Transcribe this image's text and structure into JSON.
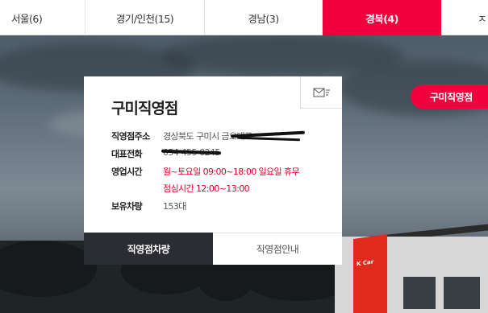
{
  "tabs": [
    {
      "label": "서울(6)"
    },
    {
      "label": "경기/인천(15)"
    },
    {
      "label": "경남(3)"
    },
    {
      "label": "경북(4)"
    },
    {
      "label": "ㅈ"
    }
  ],
  "active_tab_index": 3,
  "side_pill": {
    "label": "구미직영점"
  },
  "card": {
    "title": "구미직영점",
    "rows": [
      {
        "label": "직영점주소",
        "value": "경상북도 구미시 금오대로"
      },
      {
        "label": "대표전화",
        "value": "054-455-0245"
      },
      {
        "label": "영업시간",
        "value": "월~토요일 09:00~18:00 일요일 휴무",
        "value2": "점심시간 12:00~13:00"
      },
      {
        "label": "보유차량",
        "value": "153대"
      }
    ],
    "buttons": {
      "cars": "직영점차량",
      "info": "직영점안내"
    }
  },
  "building_sign": "K Car",
  "colors": {
    "accent": "#f0003c",
    "dark_button": "#2c2c34"
  }
}
